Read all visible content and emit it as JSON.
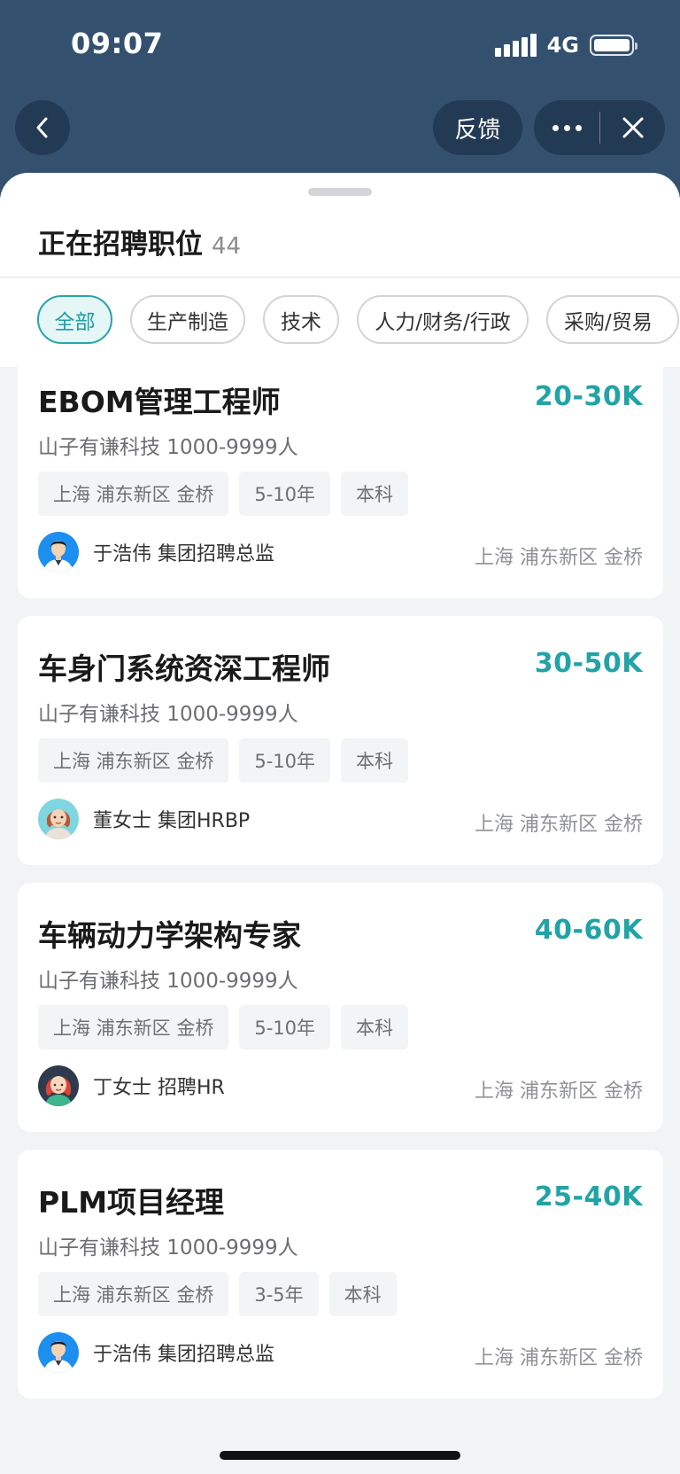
{
  "status_bar": {
    "time": "09:07",
    "network": "4G"
  },
  "nav": {
    "feedback_label": "反馈"
  },
  "sheet": {
    "title": "正在招聘职位",
    "count": "44"
  },
  "filters": [
    {
      "label": "全部",
      "active": true
    },
    {
      "label": "生产制造",
      "active": false
    },
    {
      "label": "技术",
      "active": false
    },
    {
      "label": "人力/财务/行政",
      "active": false
    },
    {
      "label": "采购/贸易",
      "active": false
    }
  ],
  "jobs": [
    {
      "title": "EBOM管理工程师",
      "salary": "20-30K",
      "company": "山子有谦科技 1000-9999人",
      "tags": [
        "上海 浦东新区 金桥",
        "5-10年",
        "本科"
      ],
      "recruiter": "于浩伟 集团招聘总监",
      "location": "上海 浦东新区 金桥",
      "avatar": "male-avatar-icon"
    },
    {
      "title": "车身门系统资深工程师",
      "salary": "30-50K",
      "company": "山子有谦科技 1000-9999人",
      "tags": [
        "上海 浦东新区 金桥",
        "5-10年",
        "本科"
      ],
      "recruiter": "董女士 集团HRBP",
      "location": "上海 浦东新区 金桥",
      "avatar": "cartoon-woman-avatar-icon"
    },
    {
      "title": "车辆动力学架构专家",
      "salary": "40-60K",
      "company": "山子有谦科技 1000-9999人",
      "tags": [
        "上海 浦东新区 金桥",
        "5-10年",
        "本科"
      ],
      "recruiter": "丁女士 招聘HR",
      "location": "上海 浦东新区 金桥",
      "avatar": "red-hair-woman-avatar-icon"
    },
    {
      "title": "PLM项目经理",
      "salary": "25-40K",
      "company": "山子有谦科技 1000-9999人",
      "tags": [
        "上海 浦东新区 金桥",
        "3-5年",
        "本科"
      ],
      "recruiter": "于浩伟 集团招聘总监",
      "location": "上海 浦东新区 金桥",
      "avatar": "male-avatar-icon"
    }
  ],
  "colors": {
    "header_bg": "#34506f",
    "button_bg": "#233a55",
    "accent": "#22a3a6"
  }
}
